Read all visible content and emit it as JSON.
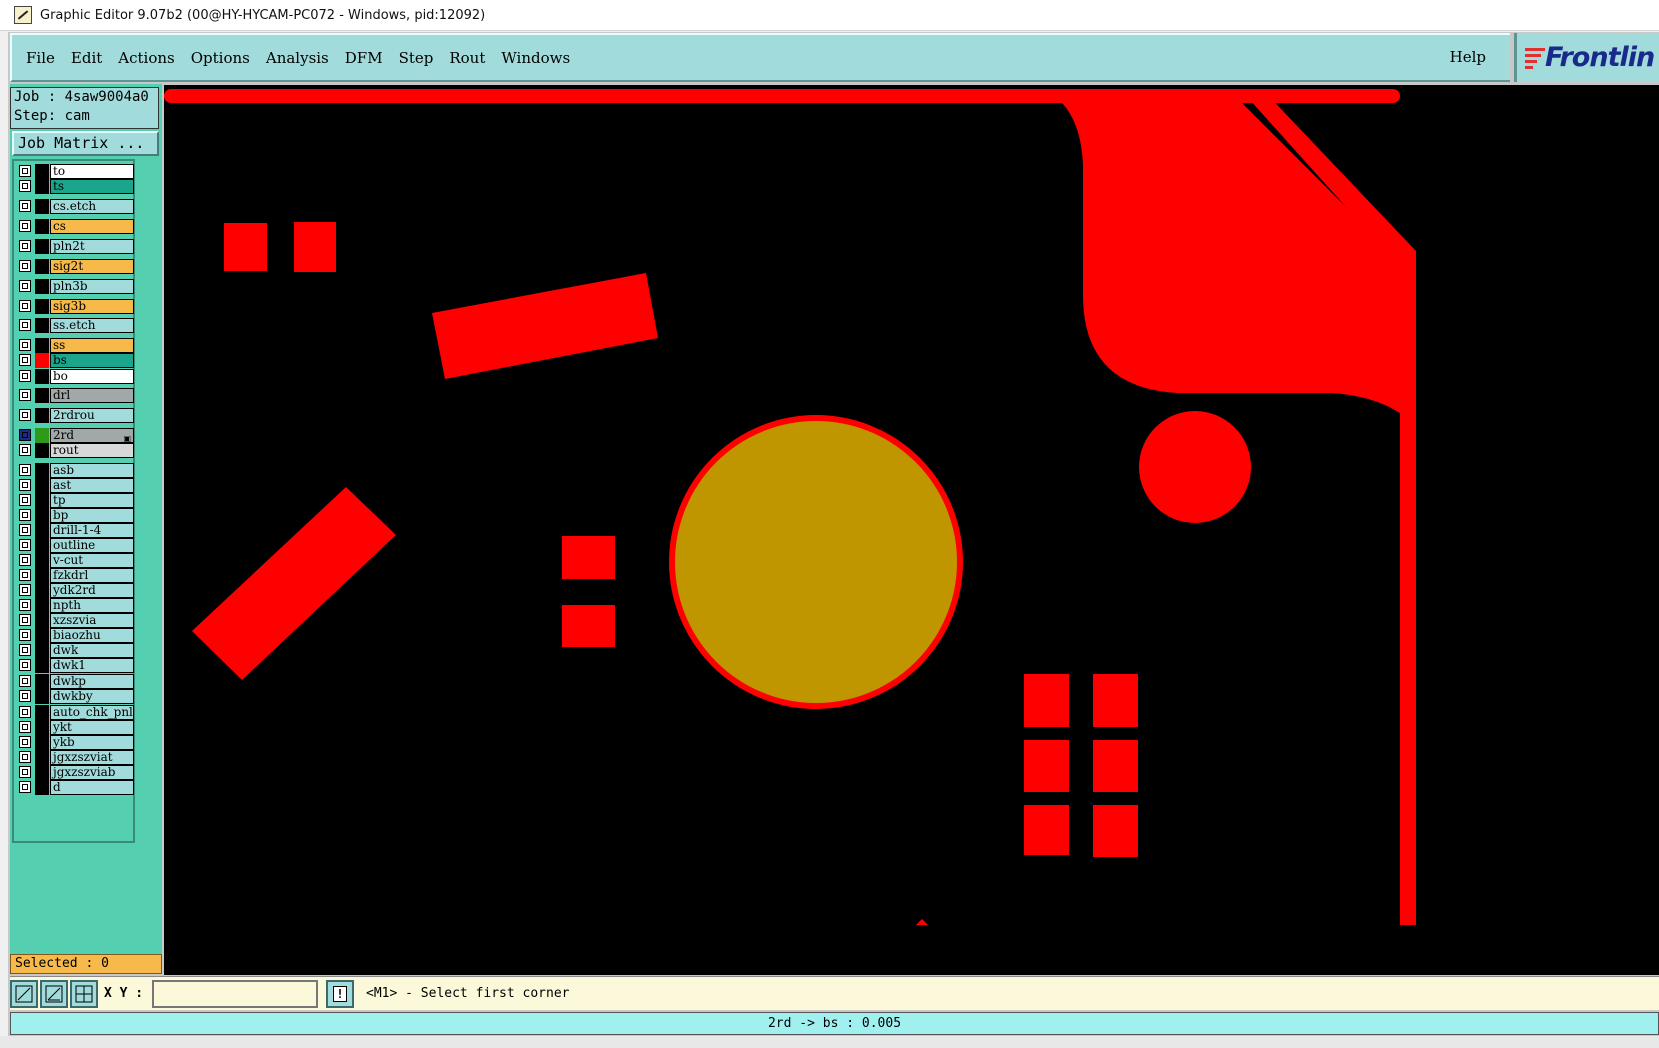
{
  "window": {
    "title": "Graphic Editor 9.07b2 (00@HY-HYCAM-PC072 - Windows, pid:12092)"
  },
  "menu": {
    "items": [
      "File",
      "Edit",
      "Actions",
      "Options",
      "Analysis",
      "DFM",
      "Step",
      "Rout",
      "Windows"
    ],
    "help": "Help"
  },
  "logo": {
    "text": "Frontlin"
  },
  "job": {
    "job_line": "Job : 4saw9004a0",
    "step_line": "Step: cam",
    "matrix_button": "Job Matrix ..."
  },
  "layers": [
    {
      "name": "to",
      "color": "#ffffff"
    },
    {
      "name": "ts",
      "color": "#1aa58c"
    },
    {
      "name": "cs.etch",
      "color": "#a1dbdb"
    },
    {
      "name": "cs",
      "color": "#f6b94a"
    },
    {
      "name": "pln2t",
      "color": "#a1dbdb"
    },
    {
      "name": "sig2t",
      "color": "#f6b94a"
    },
    {
      "name": "pln3b",
      "color": "#a1dbdb"
    },
    {
      "name": "sig3b",
      "color": "#f6b94a"
    },
    {
      "name": "ss.etch",
      "color": "#a1dbdb"
    },
    {
      "name": "ss",
      "color": "#f6b94a"
    },
    {
      "name": "bs",
      "color": "#1aa58c",
      "swatch": "#ff0000"
    },
    {
      "name": "bo",
      "color": "#ffffff"
    },
    {
      "name": "drl",
      "color": "#a0a8a8"
    },
    {
      "name": "2rdrou",
      "color": "#a1dbdb"
    },
    {
      "name": "2rd",
      "color": "#a0a8a8",
      "swatch": "#2e9a1a",
      "active": true
    },
    {
      "name": "rout",
      "color": "#d8d8d8"
    },
    {
      "name": "asb",
      "color": "#a1dbdb"
    },
    {
      "name": "ast",
      "color": "#a1dbdb"
    },
    {
      "name": "tp",
      "color": "#a1dbdb"
    },
    {
      "name": "bp",
      "color": "#a1dbdb"
    },
    {
      "name": "drill-1-4",
      "color": "#a1dbdb"
    },
    {
      "name": "outline",
      "color": "#a1dbdb"
    },
    {
      "name": "v-cut",
      "color": "#a1dbdb"
    },
    {
      "name": "fzkdrl",
      "color": "#a1dbdb"
    },
    {
      "name": "ydk2rd",
      "color": "#a1dbdb"
    },
    {
      "name": "npth",
      "color": "#a1dbdb"
    },
    {
      "name": "xzszvia",
      "color": "#a1dbdb"
    },
    {
      "name": "biaozhu",
      "color": "#a1dbdb"
    },
    {
      "name": "dwk",
      "color": "#a1dbdb"
    },
    {
      "name": "dwk1",
      "color": "#a1dbdb"
    },
    {
      "name": "dwkp",
      "color": "#a1dbdb"
    },
    {
      "name": "dwkby",
      "color": "#a1dbdb"
    },
    {
      "name": "auto_chk_pnl",
      "color": "#a1dbdb"
    },
    {
      "name": "ykt",
      "color": "#a1dbdb"
    },
    {
      "name": "ykb",
      "color": "#a1dbdb"
    },
    {
      "name": "jgxzszviat",
      "color": "#a1dbdb"
    },
    {
      "name": "jgxzszviab",
      "color": "#a1dbdb"
    },
    {
      "name": "d",
      "color": "#a1dbdb"
    }
  ],
  "selected": "Selected : 0",
  "command": {
    "xy_label": "X Y :",
    "xy_value": "",
    "info_glyph": "!",
    "prompt": "<M1> - Select first corner"
  },
  "status": "2rd -> bs : 0.005",
  "colors": {
    "feature": "#ff0000",
    "drill": "#bf9600",
    "canvas": "#000000",
    "panel": "#a1dbdb"
  }
}
